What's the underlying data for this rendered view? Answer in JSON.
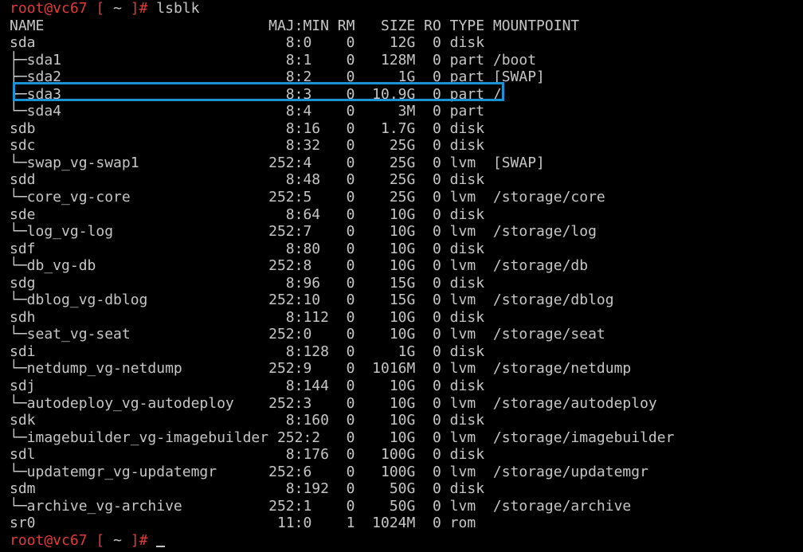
{
  "prompt": {
    "user_host": "root@vc67",
    "open": " [ ",
    "cwd": "~",
    "close": " ]# "
  },
  "command": "lsblk",
  "header": "NAME                          MAJ:MIN RM   SIZE RO TYPE MOUNTPOINT",
  "rows": [
    "sda                             8:0    0    12G  0 disk ",
    "├─sda1                          8:1    0   128M  0 part /boot",
    "├─sda2                          8:2    0     1G  0 part [SWAP]",
    "├─sda3                          8:3    0  10.9G  0 part /",
    "└─sda4                          8:4    0     3M  0 part ",
    "sdb                             8:16   0   1.7G  0 disk ",
    "sdc                             8:32   0    25G  0 disk ",
    "└─swap_vg-swap1               252:4    0    25G  0 lvm  [SWAP]",
    "sdd                             8:48   0    25G  0 disk ",
    "└─core_vg-core                252:5    0    25G  0 lvm  /storage/core",
    "sde                             8:64   0    10G  0 disk ",
    "└─log_vg-log                  252:7    0    10G  0 lvm  /storage/log",
    "sdf                             8:80   0    10G  0 disk ",
    "└─db_vg-db                    252:8    0    10G  0 lvm  /storage/db",
    "sdg                             8:96   0    15G  0 disk ",
    "└─dblog_vg-dblog              252:10   0    15G  0 lvm  /storage/dblog",
    "sdh                             8:112  0    10G  0 disk ",
    "└─seat_vg-seat                252:0    0    10G  0 lvm  /storage/seat",
    "sdi                             8:128  0     1G  0 disk ",
    "└─netdump_vg-netdump          252:9    0  1016M  0 lvm  /storage/netdump",
    "sdj                             8:144  0    10G  0 disk ",
    "└─autodeploy_vg-autodeploy    252:3    0    10G  0 lvm  /storage/autodeploy",
    "sdk                             8:160  0    10G  0 disk ",
    "└─imagebuilder_vg-imagebuilder 252:2   0    10G  0 lvm  /storage/imagebuilder",
    "sdl                             8:176  0   100G  0 disk ",
    "└─updatemgr_vg-updatemgr      252:6    0   100G  0 lvm  /storage/updatemgr",
    "sdm                             8:192  0    50G  0 disk ",
    "└─archive_vg-archive          252:1    0    50G  0 lvm  /storage/archive",
    "sr0                            11:0    1  1024M  0 rom  "
  ],
  "colors": {
    "background": "#000000",
    "text": "#c6c6c6",
    "prompt": "#e23a3a",
    "highlight": "#1a93d6"
  }
}
